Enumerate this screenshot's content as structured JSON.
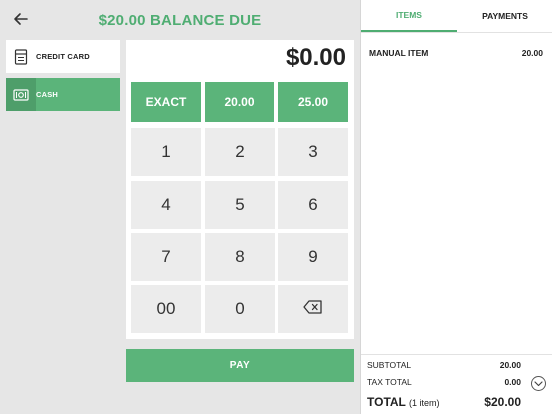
{
  "header": {
    "title": "$20.00 BALANCE DUE"
  },
  "payment_methods": [
    {
      "label": "CREDIT CARD",
      "icon": "credit-card-icon"
    },
    {
      "label": "CASH",
      "icon": "cash-icon"
    }
  ],
  "keypad": {
    "amount": "$0.00",
    "quick": [
      "EXACT",
      "20.00",
      "25.00"
    ],
    "keys": [
      "1",
      "2",
      "3",
      "4",
      "5",
      "6",
      "7",
      "8",
      "9",
      "00",
      "0"
    ],
    "backspace_icon": "backspace-icon"
  },
  "pay_label": "PAY",
  "tabs": [
    {
      "label": "ITEMS",
      "active": true
    },
    {
      "label": "PAYMENTS",
      "active": false
    }
  ],
  "items": [
    {
      "name": "MANUAL ITEM",
      "price": "20.00"
    }
  ],
  "totals": {
    "subtotal_label": "SUBTOTAL",
    "subtotal": "20.00",
    "tax_label": "TAX TOTAL",
    "tax": "0.00",
    "total_label": "TOTAL",
    "total_count": "(1 item)",
    "total": "$20.00"
  },
  "colors": {
    "accent": "#5bb47a",
    "accent_dark": "#4e9e6a",
    "title": "#4fad72"
  }
}
